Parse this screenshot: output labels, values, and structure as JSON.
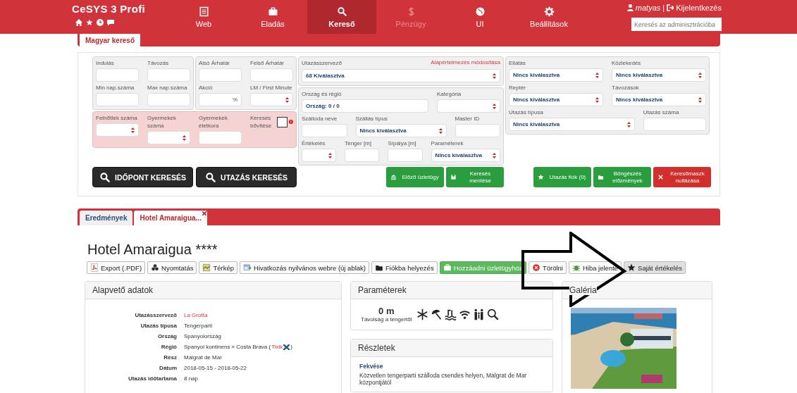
{
  "app": {
    "title": "CeSYS 3 Profi"
  },
  "nav": [
    {
      "label": "Web",
      "selected": false,
      "disabled": false
    },
    {
      "label": "Eladás",
      "selected": false,
      "disabled": false
    },
    {
      "label": "Kereső",
      "selected": true,
      "disabled": false
    },
    {
      "label": "Pénzügy",
      "selected": false,
      "disabled": true
    },
    {
      "label": "UI",
      "selected": false,
      "disabled": false
    },
    {
      "label": "Beállítások",
      "selected": false,
      "disabled": false
    }
  ],
  "user": {
    "name": "matyas",
    "separator": "|",
    "logout": "Kijelentkezés",
    "search_placeholder": "Keresés az adminisztrációba"
  },
  "search_tab": {
    "label": "Magyar kereső"
  },
  "search_form": {
    "left_groups": [
      {
        "rows": [
          [
            {
              "label": "Indulás",
              "kind": "input"
            },
            {
              "label": "Távozás",
              "kind": "input"
            }
          ],
          [
            {
              "label": "Min nap.száma",
              "kind": "input"
            },
            {
              "label": "Max nap.száma",
              "kind": "input"
            }
          ]
        ]
      },
      {
        "rows": [
          [
            {
              "label": "Alsó Árhatár",
              "kind": "input"
            },
            {
              "label": "Felső Árhatár",
              "kind": "input"
            }
          ],
          [
            {
              "label": "Akció",
              "kind": "percent",
              "value": "%"
            },
            {
              "label": "LM / First Minute",
              "kind": "select"
            }
          ]
        ]
      }
    ],
    "guests": [
      {
        "label": "Felnőttek száma",
        "kind": "select"
      },
      {
        "label": "Gyermekek száma",
        "kind": "select"
      },
      {
        "label": "Gyermekek életkora",
        "kind": "input"
      },
      {
        "label": "Keresés bővítése",
        "kind": "checkbox",
        "checked": false
      }
    ],
    "organizer": {
      "label": "Utazásszervező",
      "link": "Alapértelmezés módosítása",
      "value": "68 Kiválasztva"
    },
    "middle_rows": [
      [
        {
          "label": "Ország és régió",
          "kind": "input",
          "value": "Ország: 0 / 0"
        },
        {
          "label": "Kategória",
          "kind": "select"
        }
      ],
      [
        {
          "label": "Szálloda neve",
          "kind": "input"
        },
        {
          "label": "Szállás típus",
          "kind": "select",
          "value": "Nincs kiválasztva"
        },
        {
          "label": "Master ID",
          "kind": "input"
        }
      ],
      [
        {
          "label": "Értékelés",
          "kind": "select"
        },
        {
          "label": "Tenger [m]",
          "kind": "input"
        },
        {
          "label": "Sípálya [m]",
          "kind": "input"
        },
        {
          "label": "Paraméterek",
          "kind": "select",
          "value": "Nincs kiválasztva"
        }
      ]
    ],
    "right_rows": [
      [
        {
          "label": "Ellátás",
          "kind": "select",
          "value": "Nincs kiválasztva"
        },
        {
          "label": "Közlekedés",
          "kind": "select",
          "value": "Nincs kiválasztva"
        }
      ],
      [
        {
          "label": "Reptér",
          "kind": "select",
          "value": "Nincs kiválasztva"
        },
        {
          "label": "Távozások",
          "kind": "select",
          "value": "Nincs kiválasztva"
        }
      ],
      [
        {
          "label": "Utazás típusa",
          "kind": "select",
          "value": "Nincs kiválasztva"
        },
        {
          "label": "Utazás száma",
          "kind": "input"
        }
      ]
    ],
    "search_buttons": [
      "IDŐPONT KERESÉS",
      "UTAZÁS KERESÉS"
    ],
    "middle_buttons": [
      "Előző üzletügy",
      "Keresés mentése"
    ],
    "right_buttons": [
      "Utazás fiók (0)",
      "Böngészés előzmények",
      "Keresőmaszk nullázása"
    ]
  },
  "result_tabs": [
    {
      "label": "Eredmények",
      "selected": false
    },
    {
      "label": "Hotel Amaraigua...",
      "selected": true
    }
  ],
  "hotel": {
    "name": "Hotel Amaraigua ****"
  },
  "toolbar": [
    "Export (.PDF)",
    "Nyomtatás",
    "Térkép",
    "Hivatkozás nyilvános webre (új ablak)",
    "Fiókba helyezés",
    "Hozzáadni üzletügyhöz",
    "Törölni",
    "Hiba jelente",
    "Saját értékelés"
  ],
  "basic_data": {
    "title": "Alapvető adatok",
    "rows": [
      {
        "label": "Utazásszervező",
        "value": "La Grotta",
        "kind": "link"
      },
      {
        "label": "Utazás típusa",
        "value": "Tengerparti",
        "kind": "text"
      },
      {
        "label": "Ország",
        "value": "Spanyolország",
        "kind": "text"
      },
      {
        "label": "Régió",
        "value": "Spanyol kontinens » Costa Brava (",
        "link": "Tixik",
        "suffix": ")",
        "kind": "region"
      },
      {
        "label": "Rész",
        "value": "Malgrat de Mar",
        "kind": "text"
      },
      {
        "label": "Dátum",
        "value": "2018-05-15 - 2018-05-22",
        "kind": "text"
      },
      {
        "label": "Utazás időtartama",
        "value": "8 nap",
        "kind": "text"
      }
    ]
  },
  "parameters": {
    "title": "Paraméterek",
    "distance": "0 m",
    "distance_label": "Távolság a tengertől"
  },
  "details": {
    "title": "Részletek",
    "heading": "Fekvése",
    "text": "Közvetlen tengerparti szálloda csendes helyen, Malgrat de Mar központjától"
  },
  "gallery": {
    "title": "Galéria",
    "kind": "picture"
  }
}
